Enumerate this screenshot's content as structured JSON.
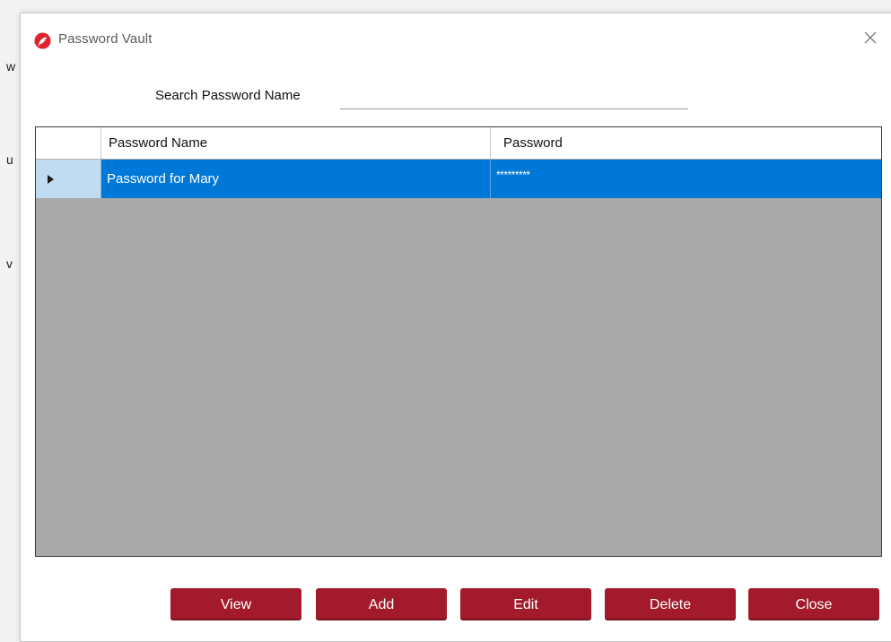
{
  "window": {
    "title": "Password Vault",
    "icon": "app-logo-icon",
    "accent_color": "#e0232e"
  },
  "search": {
    "label": "Search Password Name",
    "value": "",
    "placeholder": ""
  },
  "grid": {
    "columns": [
      "Password Name",
      "Password"
    ],
    "rows": [
      {
        "name": "Password for Mary",
        "password": "*********",
        "selected": true
      }
    ],
    "selection_color": "#0078d7",
    "empty_area_color": "#a9a9a9"
  },
  "buttons": {
    "view": "View",
    "add": "Add",
    "edit": "Edit",
    "delete": "Delete",
    "close": "Close",
    "color": "#a21a2b"
  },
  "background": {
    "letters": [
      "w",
      "u",
      "v"
    ]
  }
}
